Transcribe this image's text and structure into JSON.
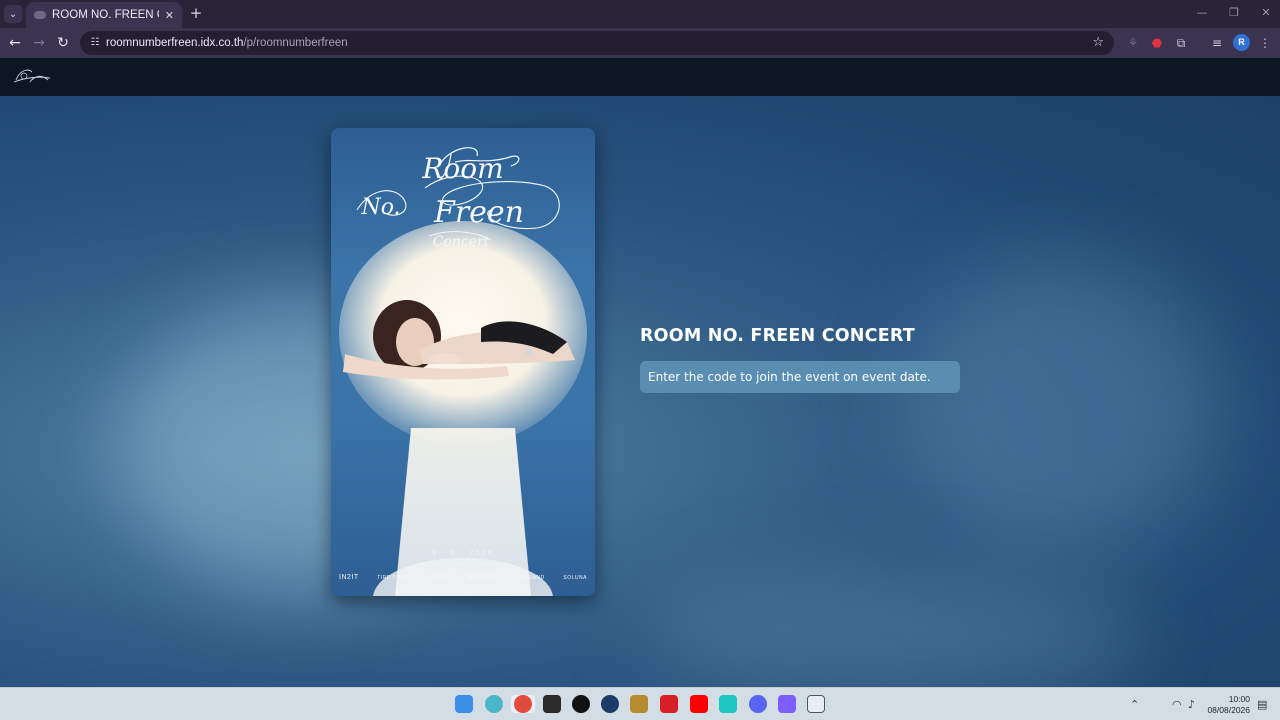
{
  "browser": {
    "tab_title": "ROOM NO. FREEN CONCERT",
    "tab_close_icon": "close-icon",
    "new_tab_icon": "plus-icon",
    "url_host": "roomnumberfreen.idx.co.th",
    "url_path": "/p/roomnumberfreen",
    "profile_initial": "R",
    "back_icon": "arrow-left-icon",
    "forward_icon": "arrow-right-icon",
    "reload_icon": "reload-icon",
    "bookmark_icon": "star-icon"
  },
  "poster": {
    "title_line1": "Room",
    "title_line2": "No.",
    "title_line3": "Freen",
    "title_line4": "Concert",
    "date": "8 . 8 . 2026",
    "venue": "THUNDER DOME,\nMUANG THONG THANI",
    "sponsors": [
      "IN2IT",
      "TIRE PHONE",
      "Grab",
      "ELEMIS",
      "THAILAND",
      "SOLUNA"
    ]
  },
  "event": {
    "title": "ROOM NO. FREEN CONCERT",
    "notice": "Enter the code to join the event on event date."
  },
  "taskbar": {
    "time": "10:00",
    "date": "08/08/2026",
    "apps": [
      "windows-start-icon",
      "copilot-icon",
      "chrome-icon",
      "epic-games-icon",
      "tiktok-icon",
      "steam-icon",
      "league-icon",
      "netflix-icon",
      "youtube-icon",
      "tiktok-live-icon",
      "discord-icon",
      "arc-icon",
      "bot-icon"
    ]
  },
  "colors": {
    "page_bg": "#2b5680",
    "notice_bg": "#5a8db2",
    "header_bg": "#0d1724",
    "chrome_bg": "#3b3450"
  }
}
